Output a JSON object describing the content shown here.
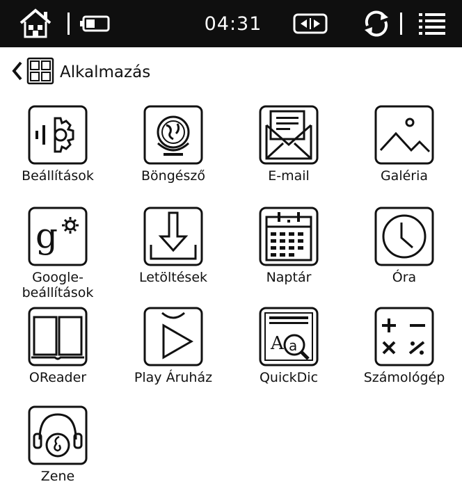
{
  "status_bar": {
    "time": "04:31",
    "icons": [
      "home-icon",
      "battery-icon",
      "screen-refresh-icon",
      "sync-icon",
      "menu-icon"
    ]
  },
  "header": {
    "title": "Alkalmazás"
  },
  "apps": [
    {
      "label": "Beállítások",
      "icon": "settings-icon"
    },
    {
      "label": "Böngésző",
      "icon": "browser-globe-icon"
    },
    {
      "label": "E-mail",
      "icon": "email-icon"
    },
    {
      "label": "Galéria",
      "icon": "gallery-icon"
    },
    {
      "label": "Google-\nbeállítások",
      "icon": "google-settings-icon"
    },
    {
      "label": "Letöltések",
      "icon": "downloads-icon"
    },
    {
      "label": "Naptár",
      "icon": "calendar-icon"
    },
    {
      "label": "Óra",
      "icon": "clock-icon"
    },
    {
      "label": "OReader",
      "icon": "book-reader-icon"
    },
    {
      "label": "Play Áruház",
      "icon": "play-store-icon"
    },
    {
      "label": "QuickDic",
      "icon": "dictionary-icon"
    },
    {
      "label": "Számológép",
      "icon": "calculator-icon"
    },
    {
      "label": "Zene",
      "icon": "music-icon"
    }
  ]
}
